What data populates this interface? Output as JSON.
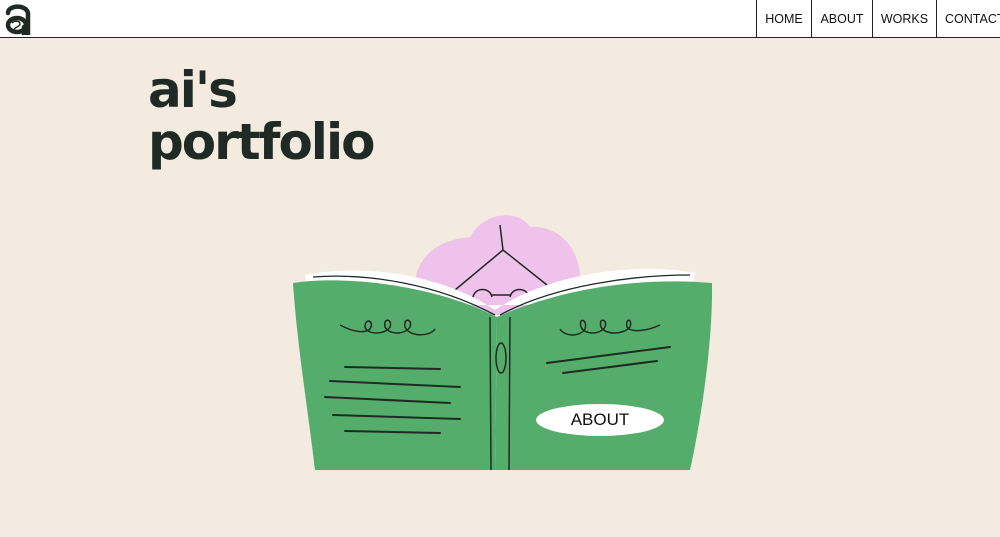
{
  "brand": {
    "logo_icon": "a-logo-icon"
  },
  "nav": {
    "items": [
      {
        "label": "HOME"
      },
      {
        "label": "ABOUT"
      },
      {
        "label": "WORKS"
      },
      {
        "label": "CONTACT"
      }
    ]
  },
  "hero": {
    "title_line1": "ai's",
    "title_line2": "portfolio",
    "about_button": "ABOUT"
  },
  "colors": {
    "background": "#f3ebdf",
    "book_green": "#55ad6c",
    "hair_pink": "#efc2ec",
    "ink": "#1f2a24"
  }
}
